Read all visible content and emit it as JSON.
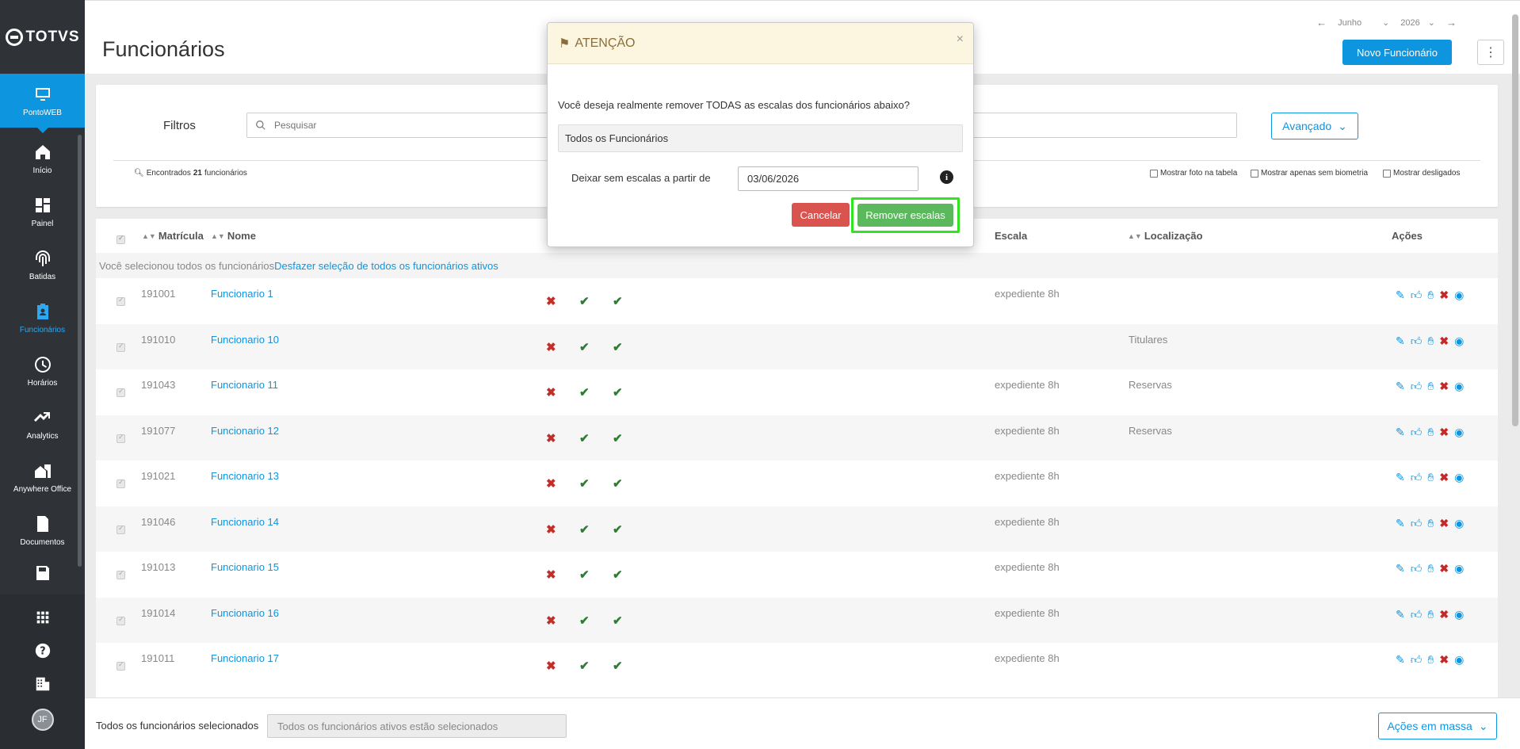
{
  "app": {
    "brand": "TOTVS",
    "product": "PontoWEB"
  },
  "sidebar": {
    "items": [
      {
        "label": "Início",
        "icon": "home-icon"
      },
      {
        "label": "Painel",
        "icon": "dashboard-icon"
      },
      {
        "label": "Batidas",
        "icon": "fingerprint-icon"
      },
      {
        "label": "Funcionários",
        "icon": "badge-icon"
      },
      {
        "label": "Horários",
        "icon": "clock-icon"
      },
      {
        "label": "Analytics",
        "icon": "trend-icon"
      },
      {
        "label": "Anywhere Office",
        "icon": "house-building-icon"
      },
      {
        "label": "Documentos",
        "icon": "document-icon"
      }
    ],
    "avatar": "JF"
  },
  "header": {
    "title": "Funcionários",
    "month": "Junho",
    "year": "2026",
    "new_button": "Novo Funcionário"
  },
  "filters": {
    "label": "Filtros",
    "search_placeholder": "Pesquisar",
    "advanced": "Avançado",
    "found_prefix": "Encontrados",
    "found_count": "21",
    "found_suffix": "funcionários",
    "options": [
      "Mostrar foto na tabela",
      "Mostrar apenas sem biometria",
      "Mostrar desligados"
    ]
  },
  "table": {
    "headers": {
      "matricula": "Matrícula",
      "nome": "Nome",
      "escala": "Escala",
      "localizacao": "Localização",
      "acoes": "Ações"
    },
    "selected_text": "Você selecionou todos os funcionários",
    "undo_link": "Desfazer seleção de todos os funcionários ativos",
    "rows": [
      {
        "matricula": "191001",
        "nome": "Funcionario 1",
        "escala": "expediente 8h",
        "loc": ""
      },
      {
        "matricula": "191010",
        "nome": "Funcionario 10",
        "escala": "",
        "loc": "Titulares"
      },
      {
        "matricula": "191043",
        "nome": "Funcionario 11",
        "escala": "expediente 8h",
        "loc": "Reservas"
      },
      {
        "matricula": "191077",
        "nome": "Funcionario 12",
        "escala": "expediente 8h",
        "loc": "Reservas"
      },
      {
        "matricula": "191021",
        "nome": "Funcionario 13",
        "escala": "expediente 8h",
        "loc": ""
      },
      {
        "matricula": "191046",
        "nome": "Funcionario 14",
        "escala": "expediente 8h",
        "loc": ""
      },
      {
        "matricula": "191013",
        "nome": "Funcionario 15",
        "escala": "expediente 8h",
        "loc": ""
      },
      {
        "matricula": "191014",
        "nome": "Funcionario 16",
        "escala": "expediente 8h",
        "loc": ""
      },
      {
        "matricula": "191011",
        "nome": "Funcionario 17",
        "escala": "expediente 8h",
        "loc": ""
      }
    ]
  },
  "footer": {
    "label": "Todos os funcionários selecionados",
    "field": "Todos os funcionários ativos estão selecionados",
    "mass_actions": "Ações em massa"
  },
  "modal": {
    "title": "ATENÇÃO",
    "close": "×",
    "question": "Você deseja realmente remover TODAS as escalas dos funcionários abaixo?",
    "employees": "Todos os Funcionários",
    "date_label": "Deixar sem escalas a partir de",
    "date_value": "03/06/2026",
    "cancel": "Cancelar",
    "confirm": "Remover escalas"
  },
  "colors": {
    "accent": "#0d95e0",
    "danger": "#d9534f",
    "success": "#5cb85c",
    "highlight": "#33e222"
  }
}
